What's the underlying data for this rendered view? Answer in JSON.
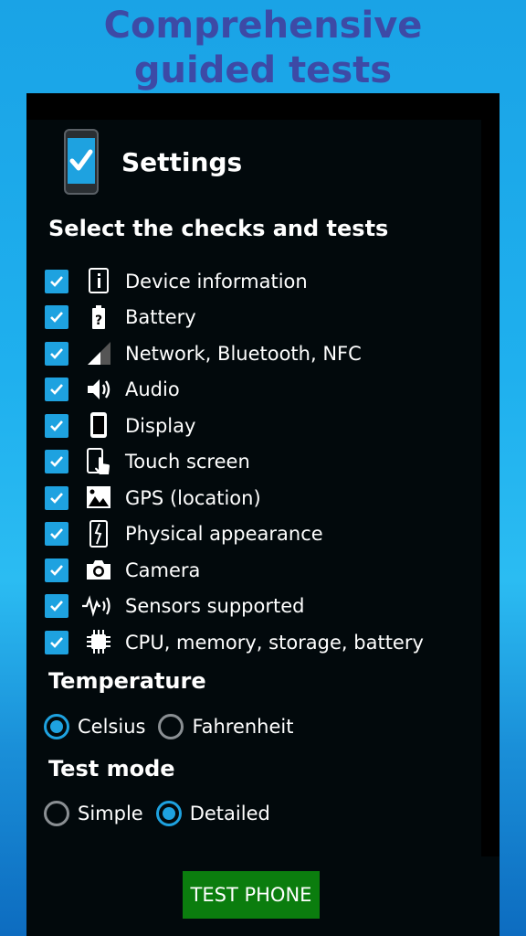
{
  "promo": {
    "line1": "Comprehensive",
    "line2": "guided tests"
  },
  "settings": {
    "title": "Settings"
  },
  "checks_section": {
    "title": "Select the checks and tests",
    "items": [
      {
        "label": "Device information",
        "icon": "info-icon",
        "checked": true
      },
      {
        "label": "Battery",
        "icon": "battery-icon",
        "checked": true
      },
      {
        "label": "Network, Bluetooth, NFC",
        "icon": "signal-icon",
        "checked": true
      },
      {
        "label": "Audio",
        "icon": "speaker-icon",
        "checked": true
      },
      {
        "label": "Display",
        "icon": "phone-display-icon",
        "checked": true
      },
      {
        "label": "Touch screen",
        "icon": "touch-icon",
        "checked": true
      },
      {
        "label": "GPS (location)",
        "icon": "landscape-image-icon",
        "checked": true
      },
      {
        "label": "Physical appearance",
        "icon": "broken-phone-icon",
        "checked": true
      },
      {
        "label": "Camera",
        "icon": "camera-icon",
        "checked": true
      },
      {
        "label": "Sensors supported",
        "icon": "sensor-icon",
        "checked": true
      },
      {
        "label": "CPU, memory, storage, battery",
        "icon": "cpu-chip-icon",
        "checked": true
      }
    ]
  },
  "temperature": {
    "title": "Temperature",
    "options": [
      {
        "label": "Celsius",
        "selected": true
      },
      {
        "label": "Fahrenheit",
        "selected": false
      }
    ]
  },
  "test_mode": {
    "title": "Test mode",
    "options": [
      {
        "label": "Simple",
        "selected": false
      },
      {
        "label": "Detailed",
        "selected": true
      }
    ]
  },
  "action": {
    "button_label": "TEST PHONE"
  },
  "colors": {
    "accent": "#1ea2e0",
    "button": "#0b7d0e",
    "headline": "#3d4aa6",
    "panel": "#02090c"
  }
}
